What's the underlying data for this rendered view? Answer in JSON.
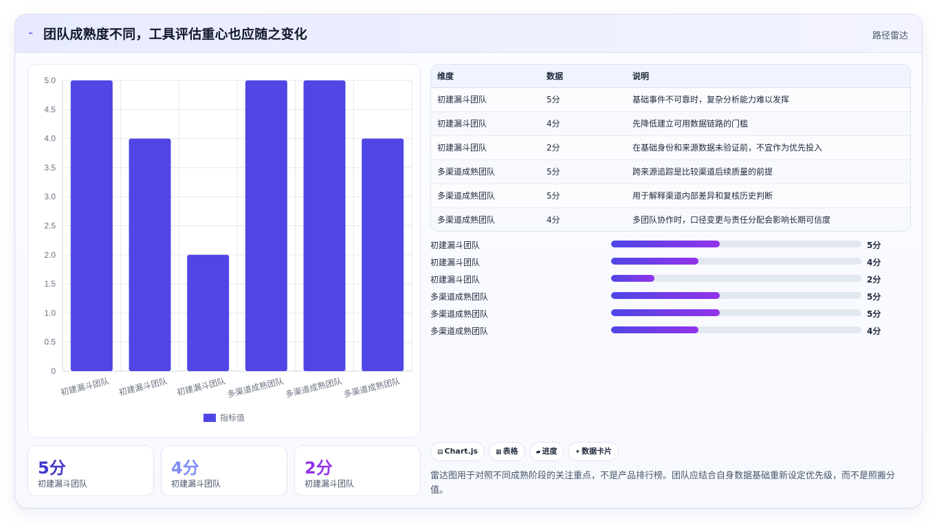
{
  "header": {
    "title": "团队成熟度不同，工具评估重心也应随之变化",
    "tag": "路径雷达",
    "icon": "sparkle-icon"
  },
  "chart_data": {
    "type": "bar",
    "categories": [
      "初建漏斗团队",
      "初建漏斗团队",
      "初建漏斗团队",
      "多渠道成熟团队",
      "多渠道成熟团队",
      "多渠道成熟团队"
    ],
    "series": [
      {
        "name": "指标值",
        "values": [
          5,
          4,
          2,
          5,
          5,
          4
        ]
      }
    ],
    "yticks": [
      "0",
      "0.5",
      "1.0",
      "1.5",
      "2.0",
      "2.5",
      "3.0",
      "3.5",
      "4.0",
      "4.5",
      "5.0"
    ],
    "ylim": [
      0,
      5
    ],
    "grid": true,
    "legend": "bottom",
    "color": "#4f46e5"
  },
  "stats": [
    {
      "value": "5分",
      "label": "初建漏斗团队",
      "color": "#4338ca"
    },
    {
      "value": "4分",
      "label": "初建漏斗团队",
      "color": "#818cf8"
    },
    {
      "value": "2分",
      "label": "初建漏斗团队",
      "color": "#9333ea"
    }
  ],
  "table": {
    "headers": [
      "维度",
      "数据",
      "说明"
    ],
    "rows": [
      [
        "初建漏斗团队",
        "5分",
        "基础事件不可靠时，复杂分析能力难以发挥"
      ],
      [
        "初建漏斗团队",
        "4分",
        "先降低建立可用数据链路的门槛"
      ],
      [
        "初建漏斗团队",
        "2分",
        "在基础身份和来源数据未验证前，不宜作为优先投入"
      ],
      [
        "多渠道成熟团队",
        "5分",
        "跨来源追踪是比较渠道后续质量的前提"
      ],
      [
        "多渠道成熟团队",
        "5分",
        "用于解释渠道内部差异和复核历史判断"
      ],
      [
        "多渠道成熟团队",
        "4分",
        "多团队协作时，口径变更与责任分配会影响长期可信度"
      ]
    ]
  },
  "progress": {
    "max": 5,
    "rows": [
      {
        "label": "初建漏斗团队",
        "value": 5,
        "text": "5分"
      },
      {
        "label": "初建漏斗团队",
        "value": 4,
        "text": "4分"
      },
      {
        "label": "初建漏斗团队",
        "value": 2,
        "text": "2分"
      },
      {
        "label": "多渠道成熟团队",
        "value": 5,
        "text": "5分"
      },
      {
        "label": "多渠道成熟团队",
        "value": 5,
        "text": "5分"
      },
      {
        "label": "多渠道成熟团队",
        "value": 4,
        "text": "4分"
      }
    ]
  },
  "chips": [
    {
      "icon": "chart-icon",
      "glyph": "▤",
      "label": "Chart.js"
    },
    {
      "icon": "table-icon",
      "glyph": "▦",
      "label": "表格"
    },
    {
      "icon": "progress-icon",
      "glyph": "▰",
      "label": "进度"
    },
    {
      "icon": "card-icon",
      "glyph": "✦",
      "label": "数据卡片"
    }
  ],
  "note": "雷达图用于对照不同成熟阶段的关注重点，不是产品排行榜。团队应结合自身数据基础重新设定优先级，而不是照搬分值。"
}
